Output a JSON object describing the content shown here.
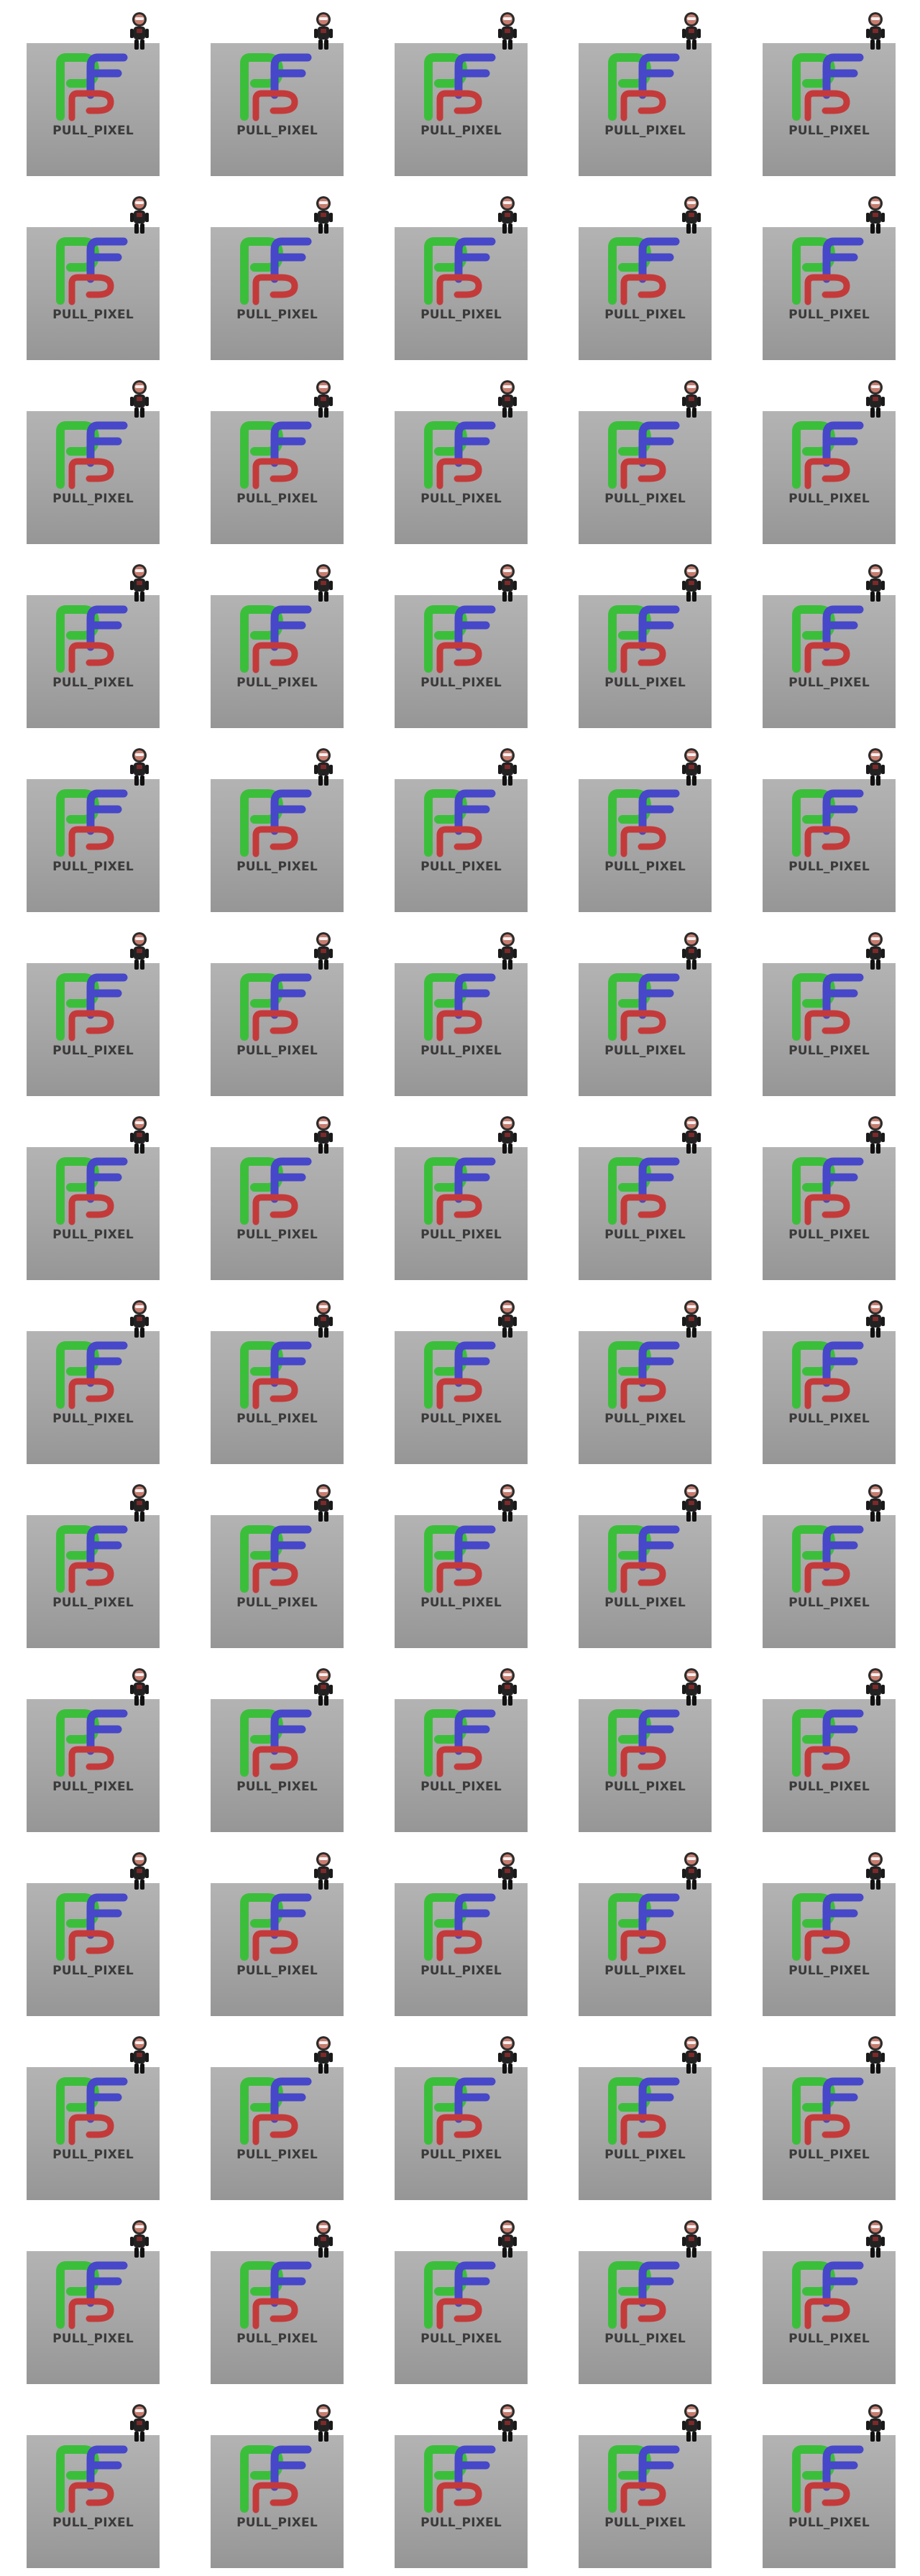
{
  "grid": {
    "rows": 14,
    "columns": 5,
    "tile_label": "PULL_PIXEL",
    "logo_icon": "pp-logo-icon",
    "mascot_icon": "robot-mascot-icon"
  },
  "colors": {
    "page_background": "#ffffff",
    "tile_light": "#b3b3b3",
    "tile_dark": "#969696",
    "logo_green": "#3bbf3b",
    "logo_blue": "#4747c9",
    "logo_red": "#c43a3a",
    "label_text": "#3a3a3a"
  }
}
